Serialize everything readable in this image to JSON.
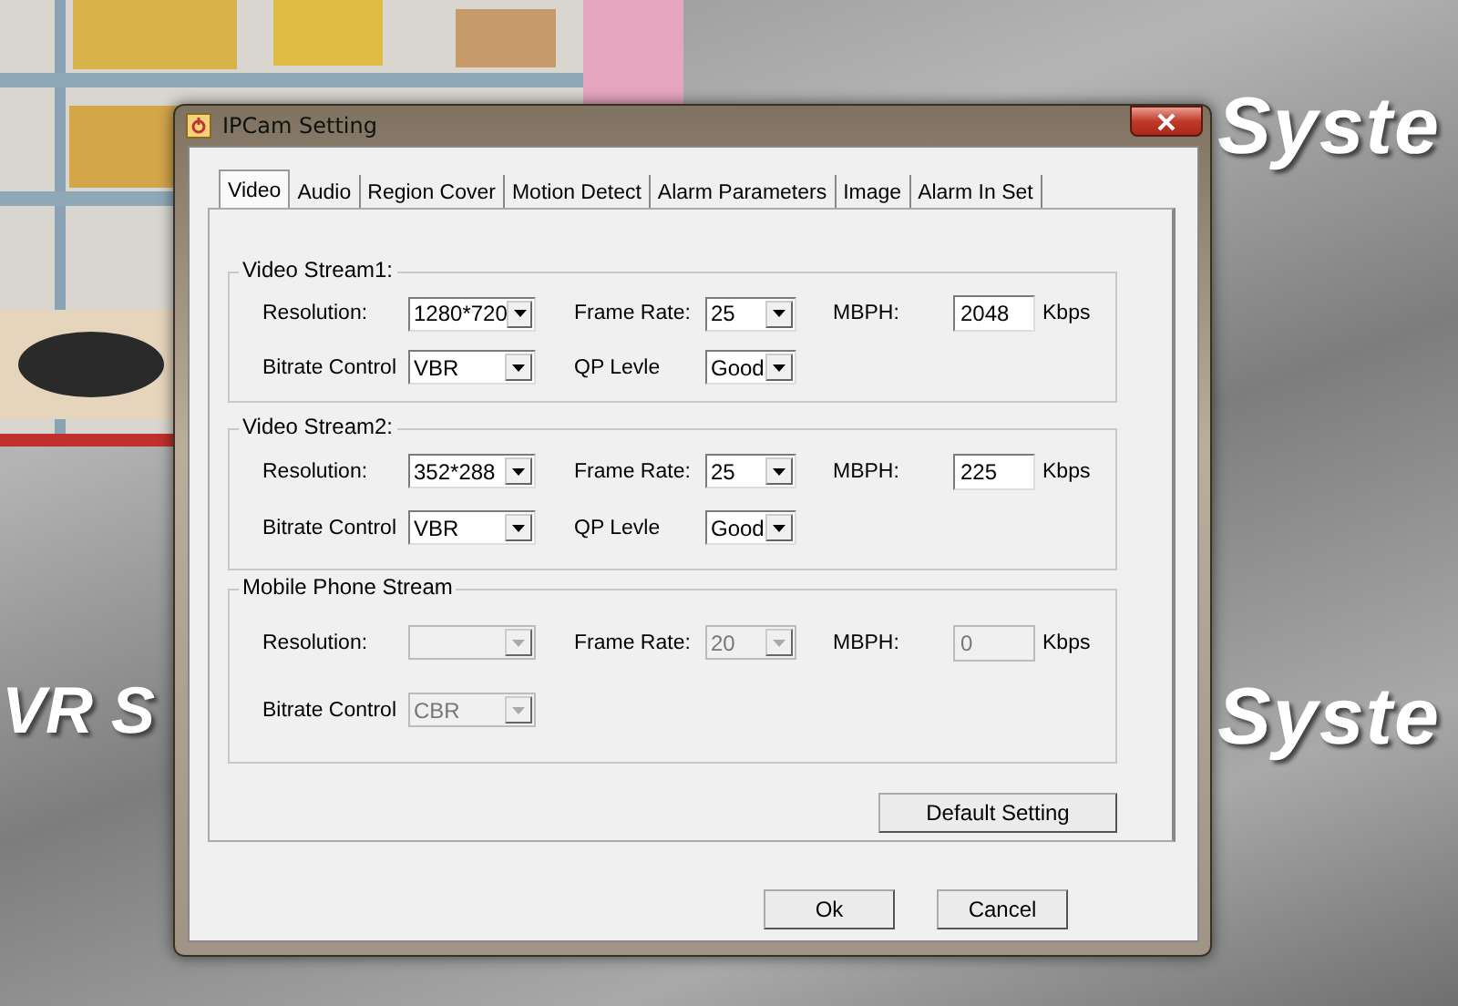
{
  "background_logo": [
    {
      "text": "Syste"
    },
    {
      "text": "VR S"
    },
    {
      "text": "Syste"
    }
  ],
  "dialog": {
    "title": "IPCam Setting",
    "tabs": [
      {
        "label": "Video",
        "selected": true
      },
      {
        "label": "Audio",
        "selected": false
      },
      {
        "label": "Region Cover",
        "selected": false
      },
      {
        "label": "Motion Detect",
        "selected": false
      },
      {
        "label": "Alarm Parameters",
        "selected": false
      },
      {
        "label": "Image",
        "selected": false
      },
      {
        "label": "Alarm In Set",
        "selected": false
      }
    ],
    "groups": [
      {
        "title": "Video Stream1:",
        "rows": [
          [
            {
              "kind": "label",
              "text": "Resolution:"
            },
            {
              "kind": "select",
              "value": "1280*720",
              "disabled": false
            },
            {
              "kind": "label",
              "text": "Frame Rate:"
            },
            {
              "kind": "select",
              "value": "25",
              "disabled": false
            },
            {
              "kind": "label",
              "text": "MBPH:"
            },
            {
              "kind": "input",
              "value": "2048",
              "disabled": false
            },
            {
              "kind": "unit",
              "text": "Kbps"
            }
          ],
          [
            {
              "kind": "label",
              "text": "Bitrate Control"
            },
            {
              "kind": "select",
              "value": "VBR",
              "disabled": false
            },
            {
              "kind": "label",
              "text": "QP Levle"
            },
            {
              "kind": "select",
              "value": "Good",
              "disabled": false
            }
          ]
        ]
      },
      {
        "title": "Video Stream2:",
        "rows": [
          [
            {
              "kind": "label",
              "text": "Resolution:"
            },
            {
              "kind": "select",
              "value": "352*288",
              "disabled": false
            },
            {
              "kind": "label",
              "text": "Frame Rate:"
            },
            {
              "kind": "select",
              "value": "25",
              "disabled": false
            },
            {
              "kind": "label",
              "text": "MBPH:"
            },
            {
              "kind": "input",
              "value": "225",
              "disabled": false
            },
            {
              "kind": "unit",
              "text": "Kbps"
            }
          ],
          [
            {
              "kind": "label",
              "text": "Bitrate Control"
            },
            {
              "kind": "select",
              "value": "VBR",
              "disabled": false
            },
            {
              "kind": "label",
              "text": "QP Levle"
            },
            {
              "kind": "select",
              "value": "Good",
              "disabled": false
            }
          ]
        ]
      },
      {
        "title": "Mobile Phone Stream",
        "rows": [
          [
            {
              "kind": "label",
              "text": "Resolution:"
            },
            {
              "kind": "select",
              "disabled": true
            },
            {
              "kind": "label",
              "text": "Frame Rate:"
            },
            {
              "kind": "select",
              "value": "20",
              "disabled": true
            },
            {
              "kind": "label",
              "text": "MBPH:"
            },
            {
              "kind": "input",
              "value": "0",
              "disabled": true
            },
            {
              "kind": "unit",
              "text": "Kbps"
            }
          ],
          [
            {
              "kind": "label",
              "text": "Bitrate Control"
            },
            {
              "kind": "select",
              "value": "CBR",
              "disabled": true
            }
          ]
        ]
      }
    ],
    "panel_button": "Default Setting",
    "buttons": [
      "Ok",
      "Cancel"
    ]
  }
}
